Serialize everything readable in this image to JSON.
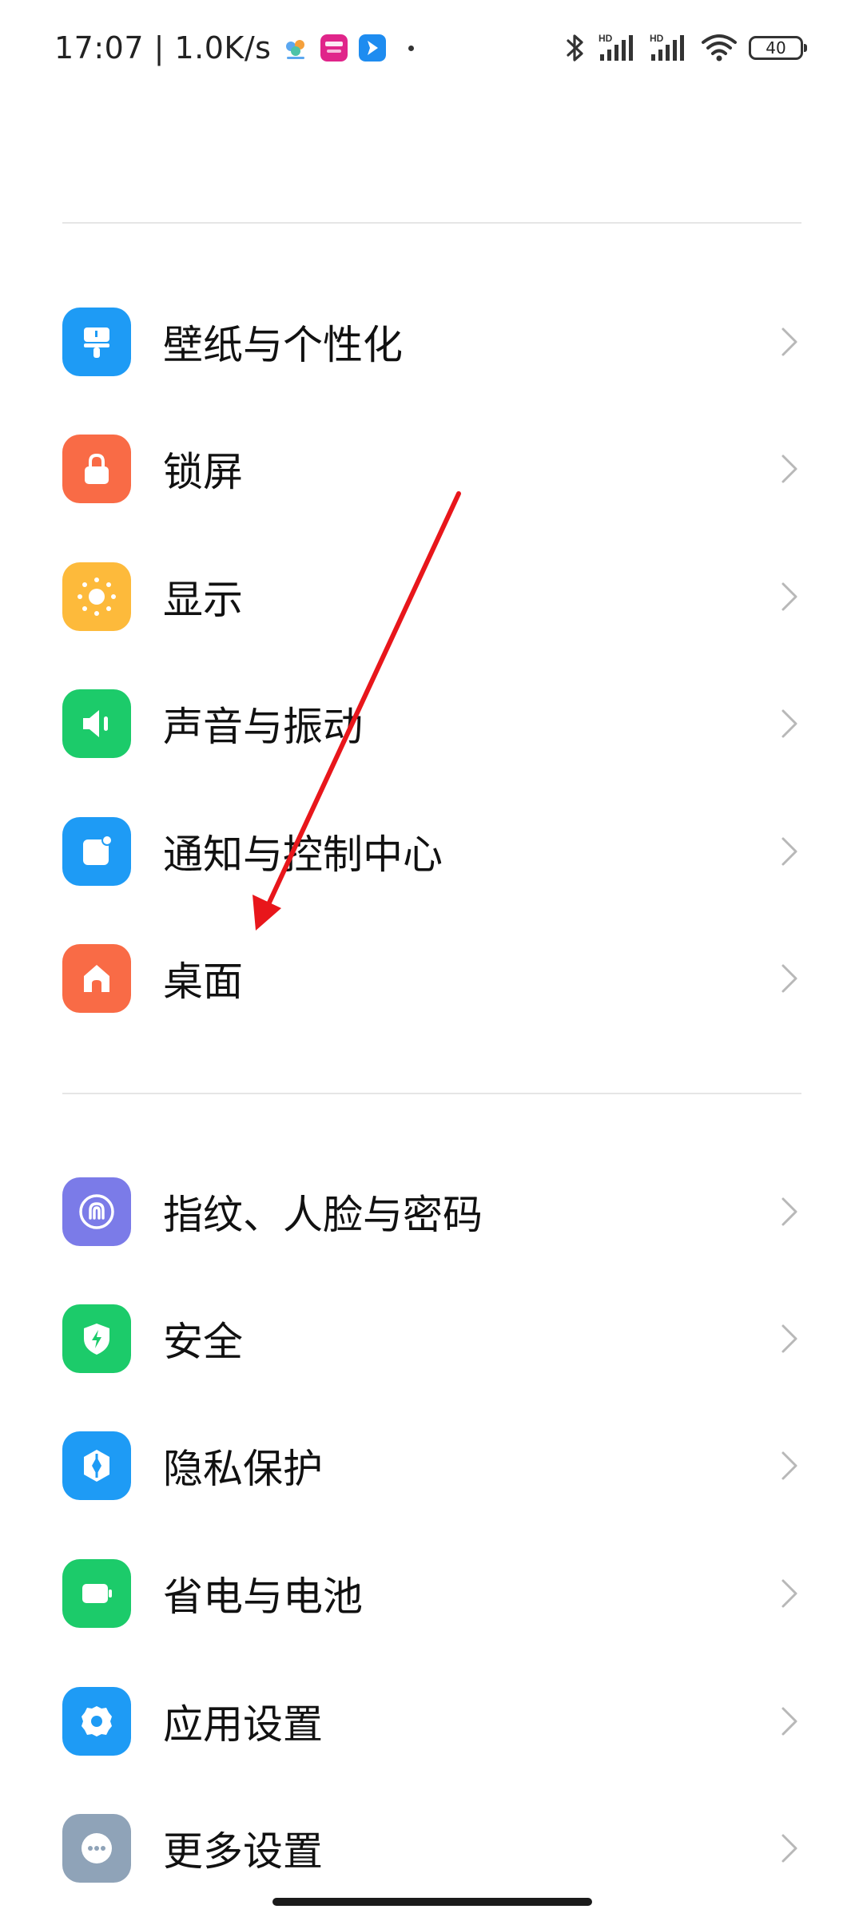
{
  "status_bar": {
    "time_and_speed": "17:07 | 1.0K/s",
    "battery_level": "40"
  },
  "settings_groups": [
    {
      "items": [
        {
          "label": "壁纸与个性化",
          "icon": "paint-brush-icon",
          "color": "#1E9BF5"
        },
        {
          "label": "锁屏",
          "icon": "lock-icon",
          "color": "#F96B46"
        },
        {
          "label": "显示",
          "icon": "sun-icon",
          "color": "#FDBA3B"
        },
        {
          "label": "声音与振动",
          "icon": "speaker-icon",
          "color": "#1CCB6A"
        },
        {
          "label": "通知与控制中心",
          "icon": "notification-icon",
          "color": "#1E9BF5"
        },
        {
          "label": "桌面",
          "icon": "home-icon",
          "color": "#F96B46"
        }
      ]
    },
    {
      "items": [
        {
          "label": "指纹、人脸与密码",
          "icon": "fingerprint-icon",
          "color": "#7B7BE8"
        },
        {
          "label": "安全",
          "icon": "shield-icon",
          "color": "#1CCB6A"
        },
        {
          "label": "隐私保护",
          "icon": "privacy-icon",
          "color": "#1E9BF5"
        },
        {
          "label": "省电与电池",
          "icon": "battery-icon",
          "color": "#1CCB6A"
        },
        {
          "label": "应用设置",
          "icon": "gear-icon",
          "color": "#1E9BF5"
        },
        {
          "label": "更多设置",
          "icon": "more-icon",
          "color": "#8FA3B8"
        }
      ]
    }
  ]
}
